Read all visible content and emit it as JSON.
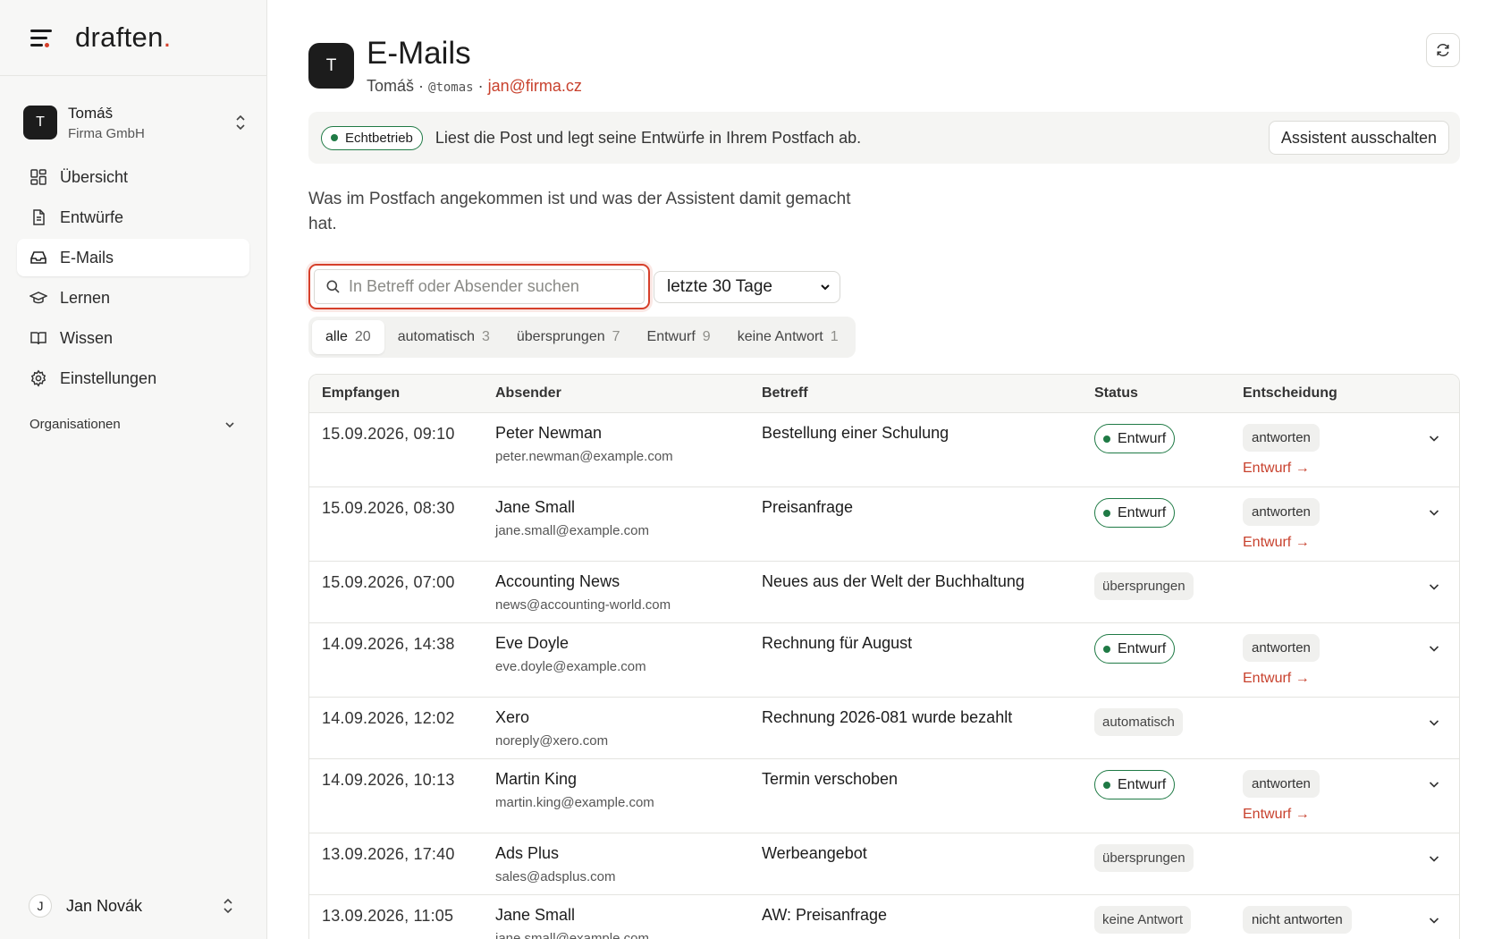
{
  "sidebar": {
    "logo_text": "draften",
    "logo_dot": ".",
    "workspace": {
      "initial": "T",
      "name": "Tomáš",
      "org": "Firma GmbH"
    },
    "nav": [
      {
        "label": "Übersicht",
        "icon": "dashboard-icon"
      },
      {
        "label": "Entwürfe",
        "icon": "document-icon"
      },
      {
        "label": "E-Mails",
        "icon": "inbox-icon",
        "active": true
      },
      {
        "label": "Lernen",
        "icon": "graduation-cap-icon"
      },
      {
        "label": "Wissen",
        "icon": "book-icon"
      },
      {
        "label": "Einstellungen",
        "icon": "gear-icon"
      }
    ],
    "organizations_label": "Organisationen",
    "user": {
      "initial": "J",
      "name": "Jan Novák"
    }
  },
  "header": {
    "avatar_initial": "T",
    "title": "E-Mails",
    "sub_name": "Tomáš",
    "sub_sep1": " · ",
    "sub_handle": "@tomas",
    "sub_sep2": " · ",
    "sub_email": "jan@firma.cz"
  },
  "banner": {
    "status_label": "Echtbetrieb",
    "text": "Liest die Post und legt seine Entwürfe in Ihrem Postfach ab.",
    "button_label": "Assistent ausschalten"
  },
  "intro": "Was im Postfach angekommen ist und was der Assistent damit gemacht hat.",
  "search": {
    "placeholder": "In Betreff oder Absender suchen",
    "value": ""
  },
  "range_select": {
    "value": "letzte 30 Tage"
  },
  "tabs": [
    {
      "label": "alle",
      "count": "20",
      "active": true
    },
    {
      "label": "automatisch",
      "count": "3"
    },
    {
      "label": "übersprungen",
      "count": "7"
    },
    {
      "label": "Entwurf",
      "count": "9"
    },
    {
      "label": "keine Antwort",
      "count": "1"
    }
  ],
  "table": {
    "headers": {
      "received": "Empfangen",
      "sender": "Absender",
      "subject": "Betreff",
      "status": "Status",
      "decision": "Entscheidung"
    },
    "rows": [
      {
        "received": "15.09.2026, 09:10",
        "sender_name": "Peter Newman",
        "sender_email": "peter.newman@example.com",
        "subject": "Bestellung einer Schulung",
        "status": "Entwurf",
        "status_type": "draft",
        "decision": "antworten",
        "draft_link": "Entwurf →"
      },
      {
        "received": "15.09.2026, 08:30",
        "sender_name": "Jane Small",
        "sender_email": "jane.small@example.com",
        "subject": "Preisanfrage",
        "status": "Entwurf",
        "status_type": "draft",
        "decision": "antworten",
        "draft_link": "Entwurf →"
      },
      {
        "received": "15.09.2026, 07:00",
        "sender_name": "Accounting News",
        "sender_email": "news@accounting-world.com",
        "subject": "Neues aus der Welt der Buchhaltung",
        "status": "übersprungen",
        "status_type": "grey",
        "decision": "",
        "draft_link": ""
      },
      {
        "received": "14.09.2026, 14:38",
        "sender_name": "Eve Doyle",
        "sender_email": "eve.doyle@example.com",
        "subject": "Rechnung für August",
        "status": "Entwurf",
        "status_type": "draft",
        "decision": "antworten",
        "draft_link": "Entwurf →"
      },
      {
        "received": "14.09.2026, 12:02",
        "sender_name": "Xero",
        "sender_email": "noreply@xero.com",
        "subject": "Rechnung 2026-081 wurde bezahlt",
        "status": "automatisch",
        "status_type": "grey",
        "decision": "",
        "draft_link": ""
      },
      {
        "received": "14.09.2026, 10:13",
        "sender_name": "Martin King",
        "sender_email": "martin.king@example.com",
        "subject": "Termin verschoben",
        "status": "Entwurf",
        "status_type": "draft",
        "decision": "antworten",
        "draft_link": "Entwurf →"
      },
      {
        "received": "13.09.2026, 17:40",
        "sender_name": "Ads Plus",
        "sender_email": "sales@adsplus.com",
        "subject": "Werbeangebot",
        "status": "übersprungen",
        "status_type": "grey",
        "decision": "",
        "draft_link": ""
      },
      {
        "received": "13.09.2026, 11:05",
        "sender_name": "Jane Small",
        "sender_email": "jane.small@example.com",
        "subject": "AW: Preisanfrage",
        "status": "keine Antwort",
        "status_type": "grey",
        "decision": "nicht antworten",
        "draft_link": ""
      }
    ]
  },
  "colors": {
    "accent": "#d6402b",
    "link": "#c8412d",
    "status_green": "#1f7a45"
  }
}
